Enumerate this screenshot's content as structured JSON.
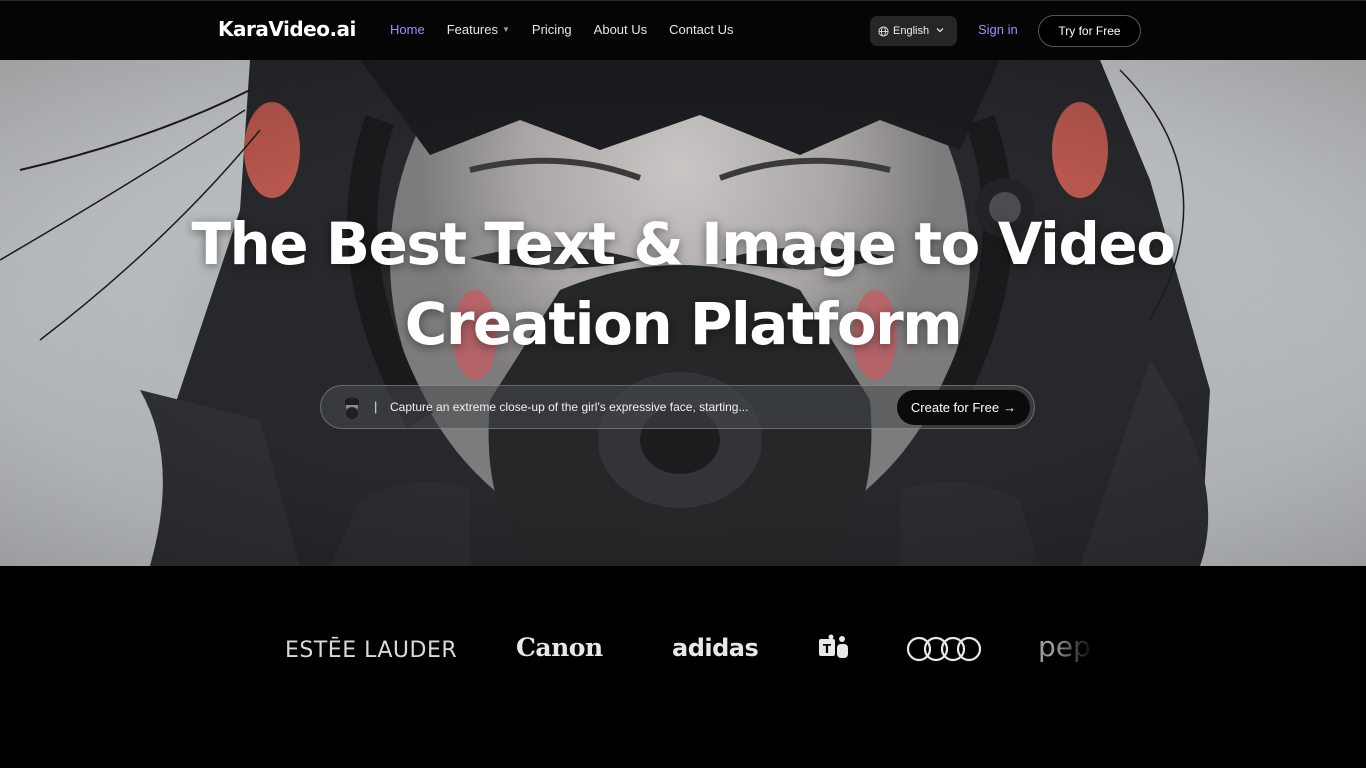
{
  "nav": {
    "logo": "KaraVideo.ai",
    "links": [
      {
        "label": "Home",
        "active": true
      },
      {
        "label": "Features",
        "has_dropdown": true
      },
      {
        "label": "Pricing"
      },
      {
        "label": "About Us"
      },
      {
        "label": "Contact Us"
      }
    ],
    "language": "English",
    "sign_in": "Sign in",
    "try_button": "Try for Free"
  },
  "hero": {
    "title": "The Best Text & Image to Video Creation Platform",
    "prompt_separator": "|",
    "prompt_text": "Capture an extreme close-up of the girl's expressive face, starting...",
    "create_button": "Create for Free",
    "create_arrow": "→"
  },
  "brands": [
    "ESTĒE LAUDER",
    "Canon",
    "adidas",
    "T",
    "audi-rings-icon",
    "pep"
  ],
  "colors": {
    "accent": "#a78bfa",
    "nav_bg": "#050505",
    "page_bg": "#000000"
  }
}
